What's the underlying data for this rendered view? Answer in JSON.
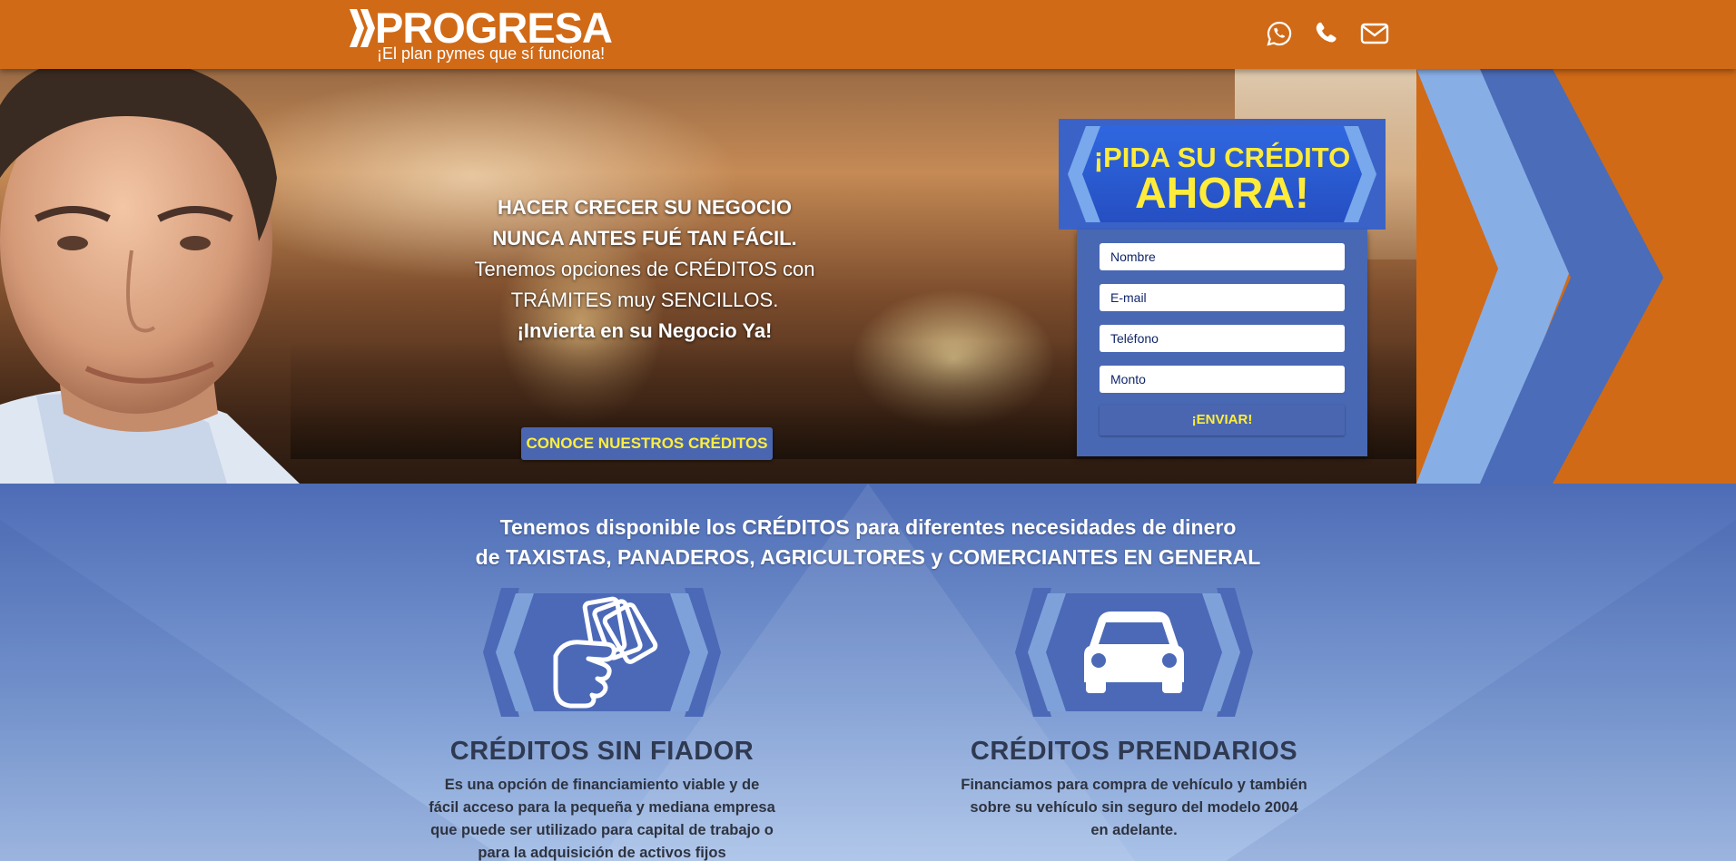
{
  "header": {
    "brand": "PROGRESA",
    "tagline": "¡El plan pymes que sí funciona!",
    "contact_icons": [
      "whatsapp-icon",
      "phone-icon",
      "mail-icon"
    ]
  },
  "hero": {
    "lines": [
      "HACER CRECER SU NEGOCIO",
      "NUNCA ANTES FUÉ TAN FÁCIL.",
      "Tenemos opciones de CRÉDITOS con",
      "TRÁMITES muy SENCILLOS.",
      "¡Invierta en su Negocio Ya!"
    ],
    "cta_label": "CONOCE NUESTROS CRÉDITOS"
  },
  "form": {
    "title_line1": "¡PIDA SU CRÉDITO",
    "title_line2": "AHORA!",
    "fields": {
      "name_placeholder": "Nombre",
      "email_placeholder": "E-mail",
      "phone_placeholder": "Teléfono",
      "amount_placeholder": "Monto"
    },
    "submit_label": "¡ENVIAR!"
  },
  "lower": {
    "title_line1": "Tenemos disponible los CRÉDITOS para diferentes necesidades de dinero",
    "title_line2": "de TAXISTAS, PANADEROS, AGRICULTORES y COMERCIANTES EN GENERAL",
    "features": [
      {
        "icon": "money-hand-icon",
        "title": "CRÉDITOS SIN FIADOR",
        "desc": "Es una opción de financiamiento viable y de fácil acceso para la pequeña y mediana empresa que puede ser utilizado para capital de trabajo o para la adquisición de activos fijos"
      },
      {
        "icon": "car-icon",
        "title": "CRÉDITOS PRENDARIOS",
        "desc": "Financiamos para compra de vehículo y también sobre su vehículo sin seguro del modelo 2004 en adelante."
      }
    ]
  },
  "colors": {
    "header_orange": "#d06a17",
    "brand_blue": "#4a66b0",
    "accent_yellow": "#ffee3a"
  }
}
